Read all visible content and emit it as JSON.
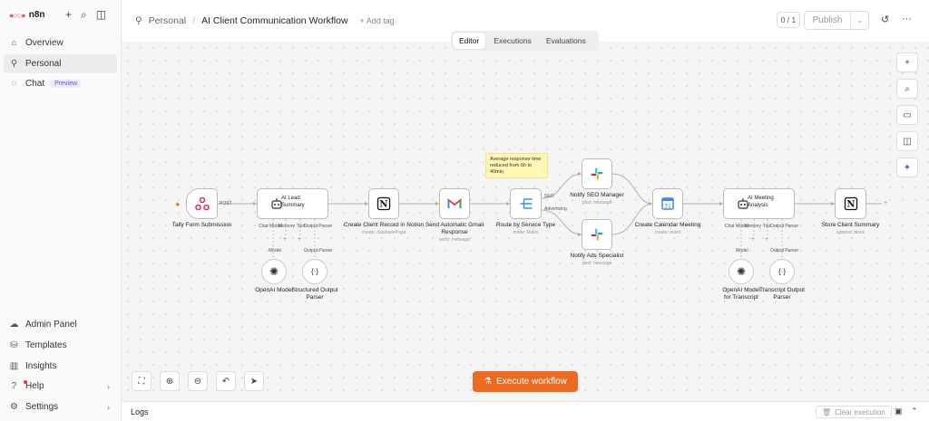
{
  "app": {
    "name": "n8n"
  },
  "sidebar": {
    "items": [
      {
        "label": "Overview",
        "icon": "home-icon"
      },
      {
        "label": "Personal",
        "icon": "user-icon"
      },
      {
        "label": "Chat",
        "icon": "chat-icon",
        "badge": "Preview"
      }
    ],
    "bottom_items": [
      {
        "label": "Admin Panel",
        "icon": "cloud-icon"
      },
      {
        "label": "Templates",
        "icon": "templates-icon"
      },
      {
        "label": "Insights",
        "icon": "chart-icon"
      },
      {
        "label": "Help",
        "icon": "help-icon"
      },
      {
        "label": "Settings",
        "icon": "gear-icon"
      }
    ]
  },
  "header": {
    "project": "Personal",
    "workflow_title": "AI Client Communication Workflow",
    "add_tag": "+ Add tag",
    "counter": "0 / 1",
    "publish_label": "Publish"
  },
  "tabs": [
    {
      "label": "Editor",
      "active": true
    },
    {
      "label": "Executions",
      "active": false
    },
    {
      "label": "Evaluations",
      "active": false
    }
  ],
  "sticky_note": "Average response time reduced from 6h to 40min",
  "nodes": {
    "tally": {
      "label": "Tally Form Submission"
    },
    "ai_lead": {
      "label": "AI Lead Summary"
    },
    "openai_1": {
      "label": "OpenAI Model"
    },
    "parser_1": {
      "label": "Structured Output Parser"
    },
    "notion_create": {
      "label": "Create Client Record in Notion",
      "sub": "create: databasePage"
    },
    "gmail": {
      "label": "Send Automatic Gmail Response",
      "sub": "send: message"
    },
    "router": {
      "label": "Route by Service Type",
      "sub": "mode: Rules"
    },
    "slack_seo": {
      "label": "Notify SEO Manager",
      "sub": "post: message"
    },
    "slack_ads": {
      "label": "Notify Ads Specialist",
      "sub": "post: message"
    },
    "calendar": {
      "label": "Create Calendar Meeting",
      "sub": "create: event"
    },
    "ai_meeting": {
      "label": "AI Meeting Analysis"
    },
    "openai_2": {
      "label": "OpenAI Model for Transcript"
    },
    "parser_2": {
      "label": "Transcript Output Parser"
    },
    "notion_store": {
      "label": "Store Client Summary",
      "sub": "append: block"
    }
  },
  "ports": {
    "post": "POST",
    "chat_model": "Chat Model",
    "memory": "Memory",
    "tool": "Tool",
    "output_parser": "Output Parser",
    "model": "Model",
    "seo": "SEO",
    "advertising": "Advertising"
  },
  "execute_label": "Execute workflow",
  "logs": {
    "label": "Logs",
    "clear": "Clear execution"
  },
  "colors": {
    "accent": "#ee6a20",
    "brand": "#e55b6a",
    "sticky": "#fff7b3"
  }
}
